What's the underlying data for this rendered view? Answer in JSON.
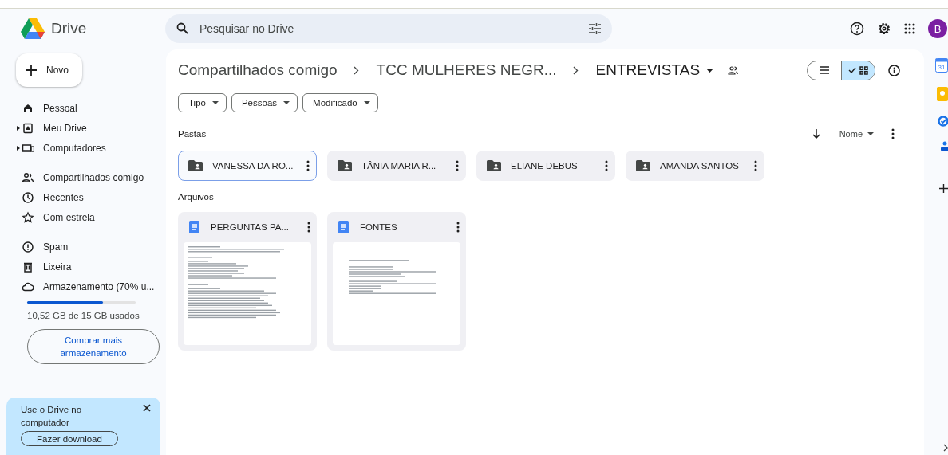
{
  "app": {
    "name": "Drive",
    "search_placeholder": "Pesquisar no Drive",
    "avatar": "B"
  },
  "new_button": "Novo",
  "sidebar": {
    "items": [
      {
        "label": "Pessoal",
        "kind": "home",
        "expandable": false
      },
      {
        "label": "Meu Drive",
        "kind": "drive",
        "expandable": true
      },
      {
        "label": "Computadores",
        "kind": "computer",
        "expandable": true
      },
      {
        "label": "Compartilhados comigo",
        "kind": "shared",
        "expandable": false
      },
      {
        "label": "Recentes",
        "kind": "clock",
        "expandable": false
      },
      {
        "label": "Com estrela",
        "kind": "star",
        "expandable": false
      },
      {
        "label": "Spam",
        "kind": "spam",
        "expandable": false
      },
      {
        "label": "Lixeira",
        "kind": "trash",
        "expandable": false
      },
      {
        "label": "Armazenamento (70% u...",
        "kind": "cloud",
        "expandable": false
      }
    ],
    "storage": {
      "level": 0.7,
      "text": "10,52 GB de 15 GB usados"
    },
    "buy_button": "Comprar mais armazenamento",
    "promo": {
      "text": "Use o Drive no computador",
      "button": "Fazer download"
    }
  },
  "breadcrumb": [
    "Compartilhados comigo",
    "TCC MULHERES NEGR...",
    "ENTREVISTAS"
  ],
  "view": {
    "list_selected": false,
    "grid_selected": true
  },
  "filters": [
    "Tipo",
    "Pessoas",
    "Modificado"
  ],
  "sort": {
    "label": "Nome"
  },
  "folders_heading": "Pastas",
  "folders": [
    {
      "name": "VANESSA DA RO...",
      "selected": true
    },
    {
      "name": "TÂNIA MARIA R...",
      "selected": false
    },
    {
      "name": "ELIANE DEBUS",
      "selected": false
    },
    {
      "name": "AMANDA SANTOS",
      "selected": false
    }
  ],
  "files_heading": "Arquivos",
  "files": [
    {
      "name": "PERGUNTAS PA...",
      "kind": "doc"
    },
    {
      "name": "FONTES",
      "kind": "doc"
    }
  ],
  "side_panel": {
    "calendar_day": "31"
  }
}
